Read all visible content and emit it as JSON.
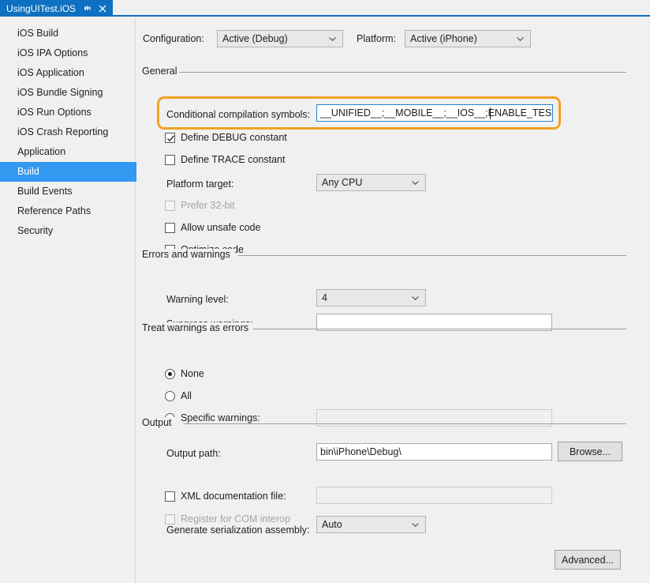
{
  "tab": {
    "title": "UsingUITest.iOS",
    "pin_icon": "pin-icon",
    "close_icon": "close-icon",
    "accent_color": "#0e70c0"
  },
  "sidebar": {
    "selected_color": "#3399f0",
    "items": [
      {
        "label": "iOS Build",
        "selected": false
      },
      {
        "label": "iOS IPA Options",
        "selected": false
      },
      {
        "label": "iOS Application",
        "selected": false
      },
      {
        "label": "iOS Bundle Signing",
        "selected": false
      },
      {
        "label": "iOS Run Options",
        "selected": false
      },
      {
        "label": "iOS Crash Reporting",
        "selected": false
      },
      {
        "label": "Application",
        "selected": false
      },
      {
        "label": "Build",
        "selected": true
      },
      {
        "label": "Build Events",
        "selected": false
      },
      {
        "label": "Reference Paths",
        "selected": false
      },
      {
        "label": "Security",
        "selected": false
      }
    ]
  },
  "config_row": {
    "configuration_label": "Configuration:",
    "configuration_value": "Active (Debug)",
    "platform_label": "Platform:",
    "platform_value": "Active (iPhone)"
  },
  "general": {
    "title": "General",
    "conditional_symbols_label": "Conditional compilation symbols:",
    "conditional_symbols_value": "__UNIFIED__;__MOBILE__;__IOS__;ENABLE_TEST_CLOUD;",
    "define_debug_label": "Define DEBUG constant",
    "define_debug_checked": true,
    "define_trace_label": "Define TRACE constant",
    "define_trace_checked": false,
    "platform_target_label": "Platform target:",
    "platform_target_value": "Any CPU",
    "prefer32_label": "Prefer 32-bit",
    "prefer32_checked": false,
    "prefer32_disabled": true,
    "allow_unsafe_label": "Allow unsafe code",
    "allow_unsafe_checked": false,
    "optimize_label": "Optimize code",
    "optimize_checked": false,
    "highlight_color": "#f0a323"
  },
  "errors_warnings": {
    "title": "Errors and warnings",
    "warning_level_label": "Warning level:",
    "warning_level_value": "4",
    "suppress_label": "Suppress warnings:",
    "suppress_value": ""
  },
  "treat_warnings": {
    "title": "Treat warnings as errors",
    "none_label": "None",
    "all_label": "All",
    "specific_label": "Specific warnings:",
    "specific_value": "",
    "selected": "None"
  },
  "output": {
    "title": "Output",
    "output_path_label": "Output path:",
    "output_path_value": "bin\\iPhone\\Debug\\",
    "browse_label": "Browse...",
    "xml_doc_label": "XML documentation file:",
    "xml_doc_checked": false,
    "xml_doc_value": "",
    "com_interop_label": "Register for COM interop",
    "com_interop_checked": false,
    "com_interop_disabled": true,
    "serialization_label": "Generate serialization assembly:",
    "serialization_value": "Auto"
  },
  "footer": {
    "advanced_label": "Advanced..."
  }
}
